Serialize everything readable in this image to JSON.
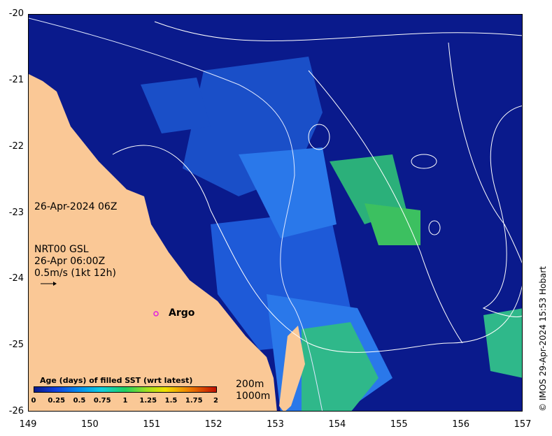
{
  "map": {
    "lon_ticks": [
      "149",
      "150",
      "151",
      "152",
      "153",
      "154",
      "155",
      "156",
      "157"
    ],
    "lat_ticks": [
      "-20",
      "-21",
      "-22",
      "-23",
      "-24",
      "-25",
      "-26"
    ],
    "lon_range": [
      149,
      157
    ],
    "lat_range": [
      -26,
      -20
    ],
    "date_label": "26-Apr-2024 06Z",
    "current_info": {
      "line1": "NRT00 GSL",
      "line2": "26-Apr 06:00Z",
      "line3": "0.5m/s (1kt 12h)"
    },
    "argo": {
      "label": "Argo",
      "lon": 151.0,
      "lat": -24.53,
      "color": "#e020e0"
    },
    "depth_labels": {
      "d200": "200m",
      "d1000": "1000m"
    },
    "credit": "© IMOS 29-Apr-2024 15:53 Hobart",
    "colors": {
      "land": "#fac896",
      "ocean_deep": "#0a1a8c",
      "ocean_mid": "#1e5ad8",
      "ocean_light": "#3a8ff0"
    }
  },
  "legend": {
    "title": "Age (days) of filled SST (wrt latest)",
    "ticks": [
      "0",
      "0.25",
      "0.5",
      "0.75",
      "1",
      "1.25",
      "1.5",
      "1.75",
      "2"
    ],
    "range": [
      0,
      2
    ]
  }
}
